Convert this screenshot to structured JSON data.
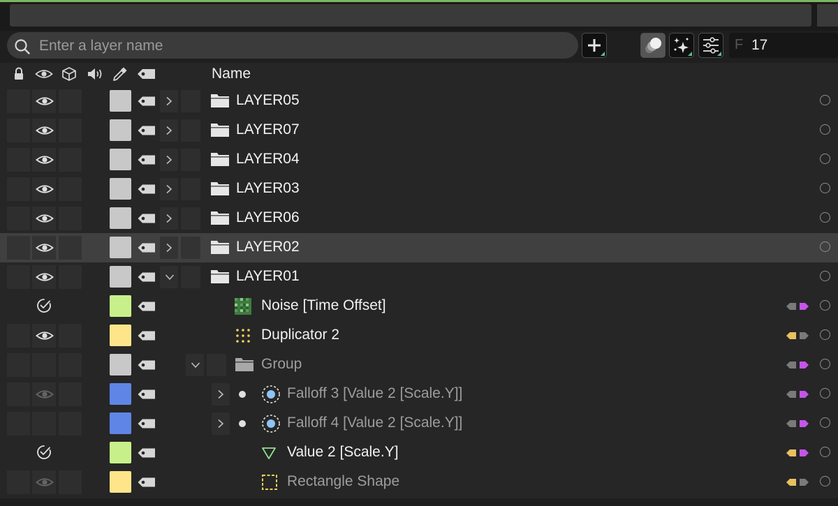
{
  "search": {
    "placeholder": "Enter a layer name",
    "value": ""
  },
  "toolbar": {
    "add_icon": "plus-icon",
    "solo_icon": "solo-spheres-icon",
    "effects_icon": "sparkle-icon",
    "filter_icon": "sliders-icon",
    "frame_prefix": "F",
    "frame_value": "17"
  },
  "header": {
    "columns": [
      "lock-icon",
      "eye-icon",
      "cube-icon",
      "speaker-icon",
      "eyedropper-icon",
      "tag-icon"
    ],
    "name_label": "Name"
  },
  "colors": {
    "accent": "#7bb661",
    "swatch_gray": "#c8c8c8",
    "swatch_green": "#c8f08a",
    "swatch_yellow": "#ffe58a",
    "swatch_blue": "#5f86e6",
    "key_gray": "#7a7a7a",
    "key_purple": "#c555e8",
    "key_yellow": "#e8c060"
  },
  "layers": [
    {
      "name": "LAYER05",
      "icon": "folder-icon",
      "state": "eye",
      "swatch": "gray",
      "expand": "collapsed",
      "depth": 0,
      "style": "white",
      "selected": false,
      "keys": null
    },
    {
      "name": "LAYER07",
      "icon": "folder-icon",
      "state": "eye",
      "swatch": "gray",
      "expand": "collapsed",
      "depth": 0,
      "style": "white",
      "selected": false,
      "keys": null
    },
    {
      "name": "LAYER04",
      "icon": "folder-icon",
      "state": "eye",
      "swatch": "gray",
      "expand": "collapsed",
      "depth": 0,
      "style": "white",
      "selected": false,
      "keys": null
    },
    {
      "name": "LAYER03",
      "icon": "folder-icon",
      "state": "eye",
      "swatch": "gray",
      "expand": "collapsed",
      "depth": 0,
      "style": "white",
      "selected": false,
      "keys": null
    },
    {
      "name": "LAYER06",
      "icon": "folder-icon",
      "state": "eye",
      "swatch": "gray",
      "expand": "collapsed",
      "depth": 0,
      "style": "white",
      "selected": false,
      "keys": null
    },
    {
      "name": "LAYER02",
      "icon": "folder-icon",
      "state": "eye",
      "swatch": "gray",
      "expand": "collapsed",
      "depth": 0,
      "style": "white",
      "selected": true,
      "keys": null
    },
    {
      "name": "LAYER01",
      "icon": "folder-icon",
      "state": "eye",
      "swatch": "gray",
      "expand": "expanded",
      "depth": 0,
      "style": "white",
      "selected": false,
      "keys": null
    },
    {
      "name": "Noise [Time Offset]",
      "icon": "noise-icon",
      "state": "check",
      "swatch": "green",
      "expand": "none",
      "depth": 1,
      "style": "white",
      "selected": false,
      "keys": [
        "gray",
        "purple"
      ]
    },
    {
      "name": "Duplicator 2",
      "icon": "duplicator-icon",
      "state": "eye",
      "swatch": "yellow",
      "expand": "none",
      "depth": 1,
      "style": "white",
      "selected": false,
      "keys": [
        "yellow",
        "gray"
      ]
    },
    {
      "name": "Group",
      "icon": "folder-icon",
      "state": "none",
      "swatch": "gray",
      "expand": "expanded",
      "depth": 1,
      "style": "gray",
      "selected": false,
      "keys": [
        "gray",
        "purple"
      ]
    },
    {
      "name": "Falloff 3 [Value 2 [Scale.Y]]",
      "icon": "falloff-icon",
      "state": "eye-dim",
      "swatch": "blue",
      "expand": "collapsed",
      "depth": 2,
      "style": "gray",
      "selected": false,
      "keys": [
        "gray",
        "purple"
      ]
    },
    {
      "name": "Falloff 4 [Value 2 [Scale.Y]]",
      "icon": "falloff-icon",
      "state": "none",
      "swatch": "blue",
      "expand": "collapsed",
      "depth": 2,
      "style": "gray",
      "selected": false,
      "keys": [
        "gray",
        "purple"
      ]
    },
    {
      "name": "Value 2 [Scale.Y]",
      "icon": "value-triangle-icon",
      "state": "check",
      "swatch": "green",
      "expand": "none",
      "depth": 2,
      "style": "white",
      "selected": false,
      "keys": [
        "yellow",
        "purple"
      ]
    },
    {
      "name": "Rectangle Shape",
      "icon": "rectangle-shape-icon",
      "state": "eye-dim",
      "swatch": "yellow",
      "expand": "none",
      "depth": 2,
      "style": "gray",
      "selected": false,
      "keys": [
        "yellow",
        "gray"
      ]
    }
  ]
}
